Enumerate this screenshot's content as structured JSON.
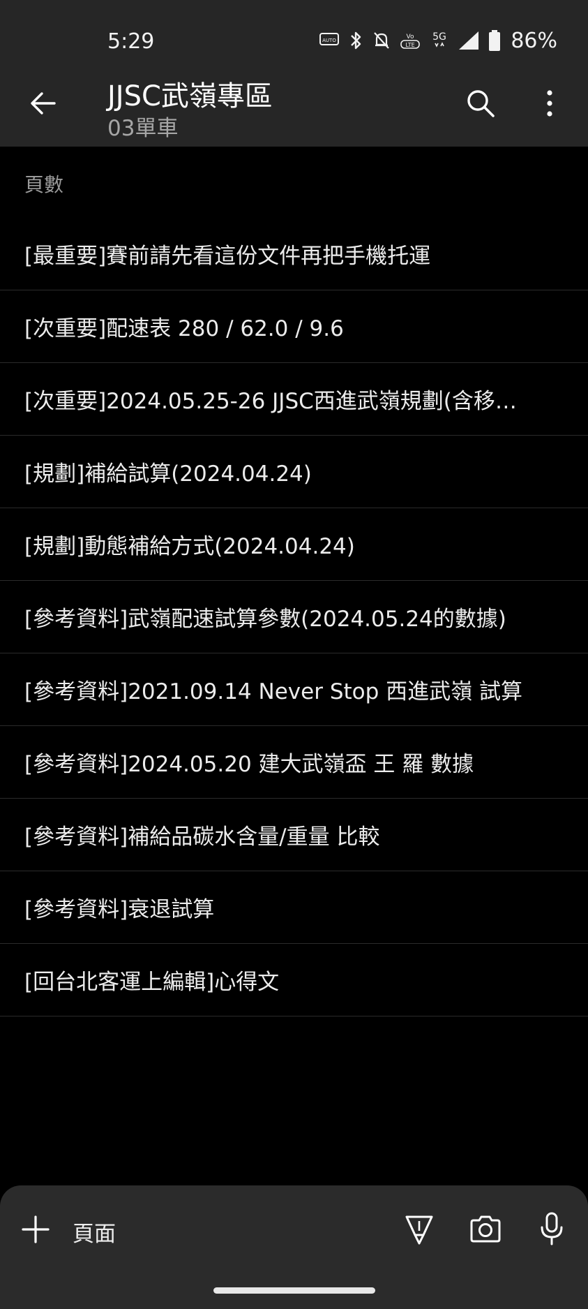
{
  "status_bar": {
    "time": "5:29",
    "icons": [
      "auto-hz-icon",
      "bluetooth-icon",
      "bell-off-icon",
      "volte-icon",
      "5g-icon",
      "signal-icon",
      "battery-icon"
    ],
    "auto_label": "AUTO",
    "network": "5G",
    "volte_label": "Vo LTE",
    "battery_percent": "86%"
  },
  "app_bar": {
    "title": "JJSC武嶺專區",
    "subtitle": "03單車"
  },
  "section": {
    "label": "頁數"
  },
  "pages": [
    {
      "label": "[最重要]賽前請先看這份文件再把手機托運"
    },
    {
      "label": "[次重要]配速表 280 / 62.0 /  9.6"
    },
    {
      "label": "[次重要]2024.05.25-26 JJSC西進武嶺規劃(含移…"
    },
    {
      "label": "[規劃]補給試算(2024.04.24)"
    },
    {
      "label": "[規劃]動態補給方式(2024.04.24)"
    },
    {
      "label": "[參考資料]武嶺配速試算參數(2024.05.24的數據)"
    },
    {
      "label": "[參考資料]2021.09.14 Never Stop 西進武嶺 試算"
    },
    {
      "label": "[參考資料]2024.05.20 建大武嶺盃 王 羅 數據"
    },
    {
      "label": "[參考資料]補給品碳水含量/重量 比較"
    },
    {
      "label": "[參考資料]衰退試算"
    },
    {
      "label": "[回台北客運上編輯]心得文"
    }
  ],
  "bottom_bar": {
    "new_page_label": "頁面"
  },
  "colors": {
    "background": "#000000",
    "bar": "#262626",
    "bottom_bar": "#2b2b2b",
    "text": "#ececec",
    "muted": "#9a9a9a",
    "divider": "#2b2b2b"
  }
}
